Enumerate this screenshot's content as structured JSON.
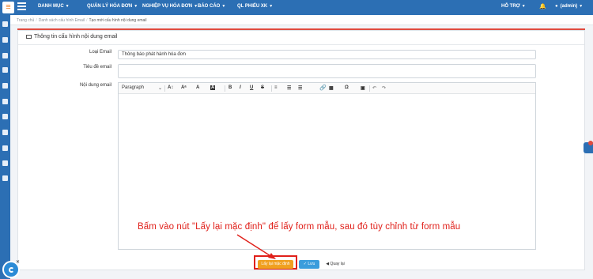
{
  "app": {
    "logo_glyph": "≡",
    "accent": "#2c6fb4",
    "highlight": "#e0201a"
  },
  "nav": {
    "items": [
      {
        "label": "DANH MỤC"
      },
      {
        "label": "QUẢN LÝ HÓA ĐƠN"
      },
      {
        "label": "NGHIỆP VỤ HÓA ĐƠN"
      },
      {
        "label": "BÁO CÁO"
      },
      {
        "label": "QL PHIẾU XK"
      }
    ],
    "support_label": "HỖ TRỢ",
    "user_label": "(admin)",
    "bell_icon": "bell-icon"
  },
  "breadcrumb": {
    "home": "Trang chủ",
    "parent": "Danh sách cấu hình Email",
    "current": "Tạo mới cấu hình nội dung email"
  },
  "panel": {
    "title": "Thông tin cấu hình nội dung email",
    "fields": {
      "email_type_label": "Loại Email",
      "email_type_value": "Thông báo phát hành hóa đơn",
      "subject_label": "Tiêu đề email",
      "subject_value": "",
      "content_label": "Nội dung email"
    },
    "editor": {
      "paragraph_label": "Paragraph",
      "tools": [
        "A↕",
        "Aᵃ",
        "A",
        "A",
        "B",
        "I",
        "U",
        "S",
        "≡",
        "☰",
        "☰",
        "🔗",
        "▦",
        "Ω",
        "▣",
        "↶",
        "↷"
      ]
    }
  },
  "annotation": "Bấm vào nút \"Lấy lại mặc định\" để lấy form mẫu, sau đó tùy chỉnh từ form mẫu",
  "buttons": {
    "default": "Lấy lại mặc định",
    "save": "Lưu",
    "back": "Quay lại"
  }
}
